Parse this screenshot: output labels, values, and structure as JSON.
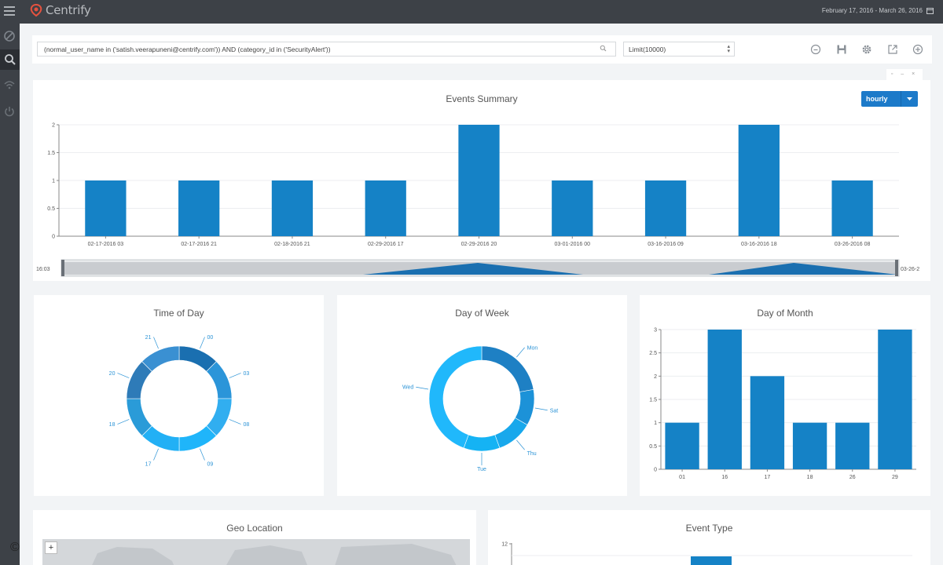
{
  "app": {
    "brand": "Centrify",
    "date_range": "February 17, 2016 - March 26, 2016"
  },
  "sidebar": {
    "items": [
      {
        "icon": "menu-icon"
      },
      {
        "icon": "dashboard-icon"
      },
      {
        "icon": "search-icon"
      },
      {
        "icon": "wifi-icon"
      },
      {
        "icon": "power-icon"
      }
    ]
  },
  "query": {
    "text": "(normal_user_name in ('satish.veerapuneni@centrify.com')) AND (category_id in ('SecurityAlert'))",
    "limit": "Limit(10000)"
  },
  "toolbar": {
    "icons": [
      "clock-icon",
      "save-icon",
      "gear-icon",
      "export-icon",
      "add-icon"
    ]
  },
  "events_summary": {
    "title": "Events Summary",
    "interval_button": "hourly",
    "range_left": "16:03",
    "range_right": "03-26-2",
    "chart_data": {
      "type": "bar",
      "categories": [
        "02-17-2016 03",
        "02-17-2016 21",
        "02-18-2016 21",
        "02-29-2016 17",
        "02-29-2016 20",
        "03-01-2016 00",
        "03-16-2016 09",
        "03-16-2016 18",
        "03-26-2016 08"
      ],
      "values": [
        1,
        1,
        1,
        1,
        2,
        1,
        1,
        2,
        1
      ],
      "yticks": [
        "0",
        "0.5",
        "1",
        "1.5",
        "2"
      ],
      "ylim": [
        0,
        2
      ],
      "color": "#1582c6"
    }
  },
  "time_of_day": {
    "title": "Time of Day",
    "chart_data": {
      "type": "pie",
      "labels": [
        "00",
        "03",
        "08",
        "09",
        "17",
        "18",
        "20",
        "21"
      ],
      "values": [
        1,
        1,
        1,
        1,
        1,
        1,
        1,
        1
      ],
      "colors": [
        "#1a6fb0",
        "#2b95d9",
        "#31aef0",
        "#1fb5fa",
        "#22b0f5",
        "#2a9bd8",
        "#2e7bb8",
        "#3a90d2"
      ]
    }
  },
  "day_of_week": {
    "title": "Day of Week",
    "chart_data": {
      "type": "pie",
      "labels": [
        "Mon",
        "Sat",
        "Thu",
        "Tue",
        "Wed"
      ],
      "values": [
        2,
        1,
        1,
        1,
        4
      ],
      "colors": [
        "#1e80c4",
        "#1c92d8",
        "#18a8ec",
        "#15b3f4",
        "#20b8fb"
      ]
    }
  },
  "day_of_month": {
    "title": "Day of Month",
    "chart_data": {
      "type": "bar",
      "categories": [
        "01",
        "16",
        "17",
        "18",
        "26",
        "29"
      ],
      "values": [
        1,
        3,
        2,
        1,
        1,
        3
      ],
      "yticks": [
        "0",
        "0.5",
        "1",
        "1.5",
        "2",
        "2.5",
        "3"
      ],
      "ylim": [
        0,
        3
      ],
      "color": "#1582c6"
    }
  },
  "geo_location": {
    "title": "Geo Location",
    "zoom_in": "+"
  },
  "event_type": {
    "title": "Event Type",
    "chart_data": {
      "type": "bar",
      "ytick_top": "12",
      "color": "#1582c6"
    }
  },
  "footer": {
    "copyright": "©"
  }
}
